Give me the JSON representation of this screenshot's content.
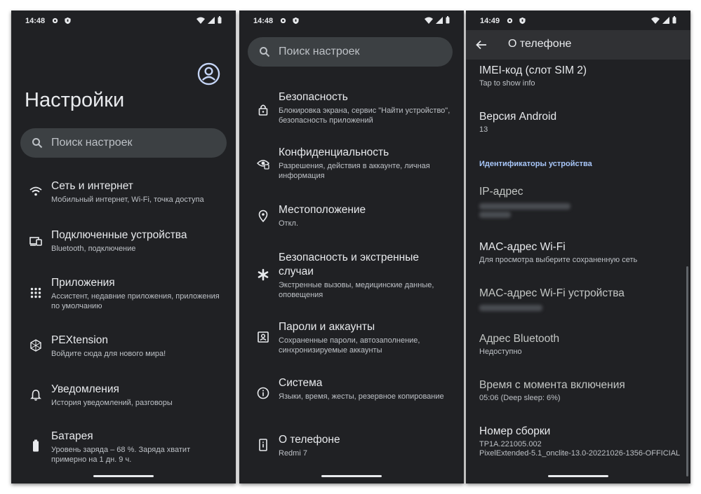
{
  "status_bar": {
    "time_1": "14:48",
    "time_2": "14:48",
    "time_3": "14:49"
  },
  "screen1": {
    "title": "Настройки",
    "search_placeholder": "Поиск настроек",
    "items": [
      {
        "icon": "wifi-icon",
        "title": "Сеть и интернет",
        "subtitle": "Мобильный интернет, Wi-Fi, точка доступа"
      },
      {
        "icon": "devices-icon",
        "title": "Подключенные устройства",
        "subtitle": "Bluetooth, подключение"
      },
      {
        "icon": "apps-grid-icon",
        "title": "Приложения",
        "subtitle": "Ассистент, недавние приложения, приложения по умолчанию"
      },
      {
        "icon": "pextension-icon",
        "title": "PEXtension",
        "subtitle": "Войдите сюда для нового мира!"
      },
      {
        "icon": "bell-icon",
        "title": "Уведомления",
        "subtitle": "История уведомлений, разговоры"
      },
      {
        "icon": "battery-icon",
        "title": "Батарея",
        "subtitle": "Уровень заряда – 68 %. Заряда хватит примерно на 1 дн. 9 ч."
      }
    ]
  },
  "screen2": {
    "search_placeholder": "Поиск настроек",
    "items": [
      {
        "icon": "lock-icon",
        "title": "Безопасность",
        "subtitle": "Блокировка экрана, сервис \"Найти устройство\", безопасность приложений"
      },
      {
        "icon": "privacy-eye-icon",
        "title": "Конфиденциальность",
        "subtitle": "Разрешения, действия в аккаунте, личная информация"
      },
      {
        "icon": "location-pin-icon",
        "title": "Местоположение",
        "subtitle": "Откл."
      },
      {
        "icon": "emergency-asterisk-icon",
        "title": "Безопасность и экстренные случаи",
        "subtitle": "Экстренные вызовы, медицинские данные, оповещения"
      },
      {
        "icon": "account-box-icon",
        "title": "Пароли и аккаунты",
        "subtitle": "Сохраненные пароли, автозаполнение, синхронизируемые аккаунты"
      },
      {
        "icon": "info-icon",
        "title": "Система",
        "subtitle": "Языки, время, жесты, резервное копирование"
      },
      {
        "icon": "phone-info-icon",
        "title": "О телефоне",
        "subtitle": "Redmi 7"
      }
    ]
  },
  "screen3": {
    "title": "О телефоне",
    "section_header": "Идентификаторы устройства",
    "items": [
      {
        "title": "IMEI-код (слот SIM 2)",
        "subtitle": "Tap to show info"
      },
      {
        "title": "Версия Android",
        "subtitle": "13"
      },
      {
        "title": "IP-адрес",
        "subtitle": ""
      },
      {
        "title": "MAC-адрес Wi-Fi",
        "subtitle": "Для просмотра выберите сохраненную сеть"
      },
      {
        "title": "MAC-адрес Wi-Fi устройства",
        "subtitle": ""
      },
      {
        "title": "Адрес Bluetooth",
        "subtitle": "Недоступно"
      },
      {
        "title": "Время с момента включения",
        "subtitle": "05:06 (Deep sleep: 6%)"
      },
      {
        "title": "Номер сборки",
        "subtitle": "TP1A.221005.002\nPixelExtended-5.1_onclite-13.0-20221026-1356-OFFICIAL"
      }
    ]
  },
  "colors": {
    "background": "#202124",
    "search_bg": "#3c4043",
    "accent": "#a8c7fa",
    "text": "#e8eaed"
  }
}
